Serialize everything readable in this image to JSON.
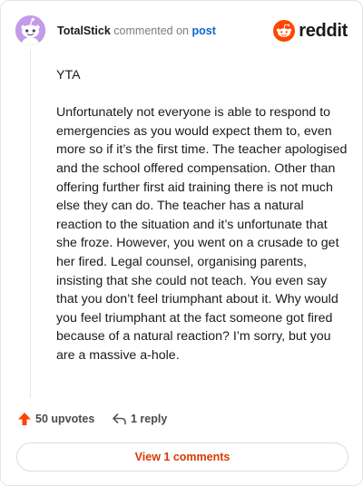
{
  "header": {
    "username": "TotalStick",
    "action_text": "commented on",
    "post_link": "post",
    "brand_name": "reddit"
  },
  "comment": {
    "paragraphs": [
      "YTA",
      "Unfortunately not everyone is able to respond to emergencies as you would expect them to, even more so if it’s the first time. The teacher apologised and the school offered compensation. Other than offering further first aid training there is not much else they can do. The teacher has a natural reaction to the situation and it’s unfortunate that she froze. However, you went on a crusade to get her fired. Legal counsel, organising parents, insisting that she could not teach. You even say that you don’t feel triumphant about it. Why would you feel triumphant at the fact someone got fired because of a natural reaction? I’m sorry, but you are a massive a-hole."
    ]
  },
  "actions": {
    "upvotes_label": "50 upvotes",
    "reply_label": "1 reply"
  },
  "footer": {
    "view_comments_label": "View 1 comments"
  },
  "colors": {
    "brand": "#ff4500",
    "link": "#0a67c9",
    "view_button_text": "#d93a00",
    "avatar_bg": "#c59ae8"
  },
  "icons": {
    "avatar": "snoo-avatar-icon",
    "brand": "reddit-logo-icon",
    "upvote": "upvote-arrow-icon",
    "reply": "reply-arrow-icon"
  }
}
